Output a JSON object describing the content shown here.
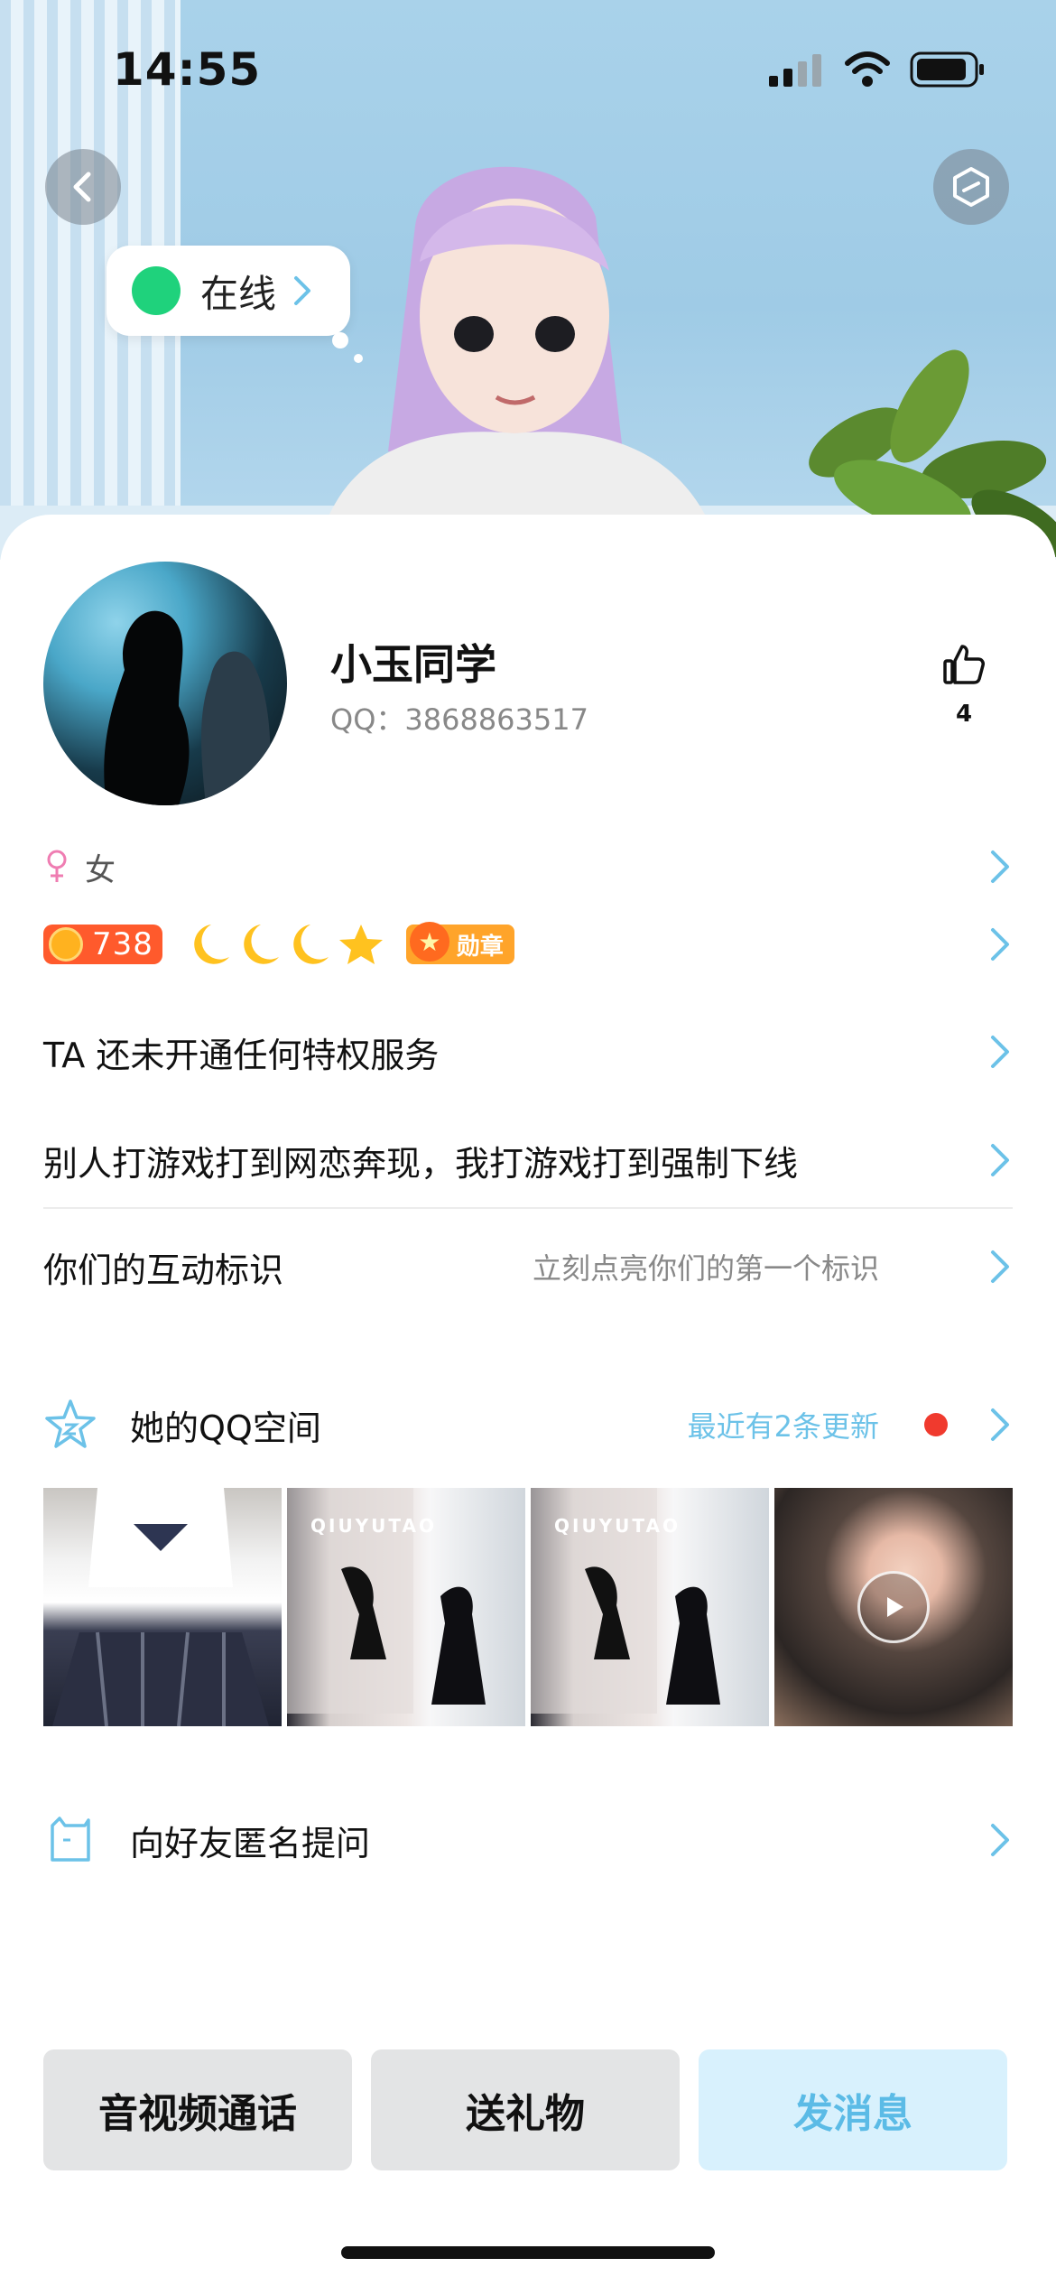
{
  "status_bar": {
    "time": "14:55"
  },
  "hero": {
    "online_status": "在线"
  },
  "profile": {
    "nickname": "小玉同学",
    "qq_line": "QQ：3868863517",
    "like_count": "4",
    "gender": "女",
    "level": "738",
    "medal_label": "勋章"
  },
  "rows": {
    "privilege": "TA 还未开通任何特权服务",
    "signature": "别人打游戏打到网恋奔现，我打游戏打到强制下线",
    "interaction_label": "你们的互动标识",
    "interaction_hint": "立刻点亮你们的第一个标识",
    "qzone_title": "她的QQ空间",
    "qzone_update": "最近有2条更新",
    "anon_question": "向好友匿名提问"
  },
  "photos": [
    {
      "caption": ""
    },
    {
      "caption": "QIUYUTAO"
    },
    {
      "caption": "QIUYUTAO"
    },
    {
      "caption": ""
    }
  ],
  "buttons": {
    "call": "音视频通话",
    "gift": "送礼物",
    "message": "发消息"
  },
  "colors": {
    "accent": "#5bbbe6",
    "online": "#1fd27c",
    "update_dot": "#f03a2e"
  }
}
